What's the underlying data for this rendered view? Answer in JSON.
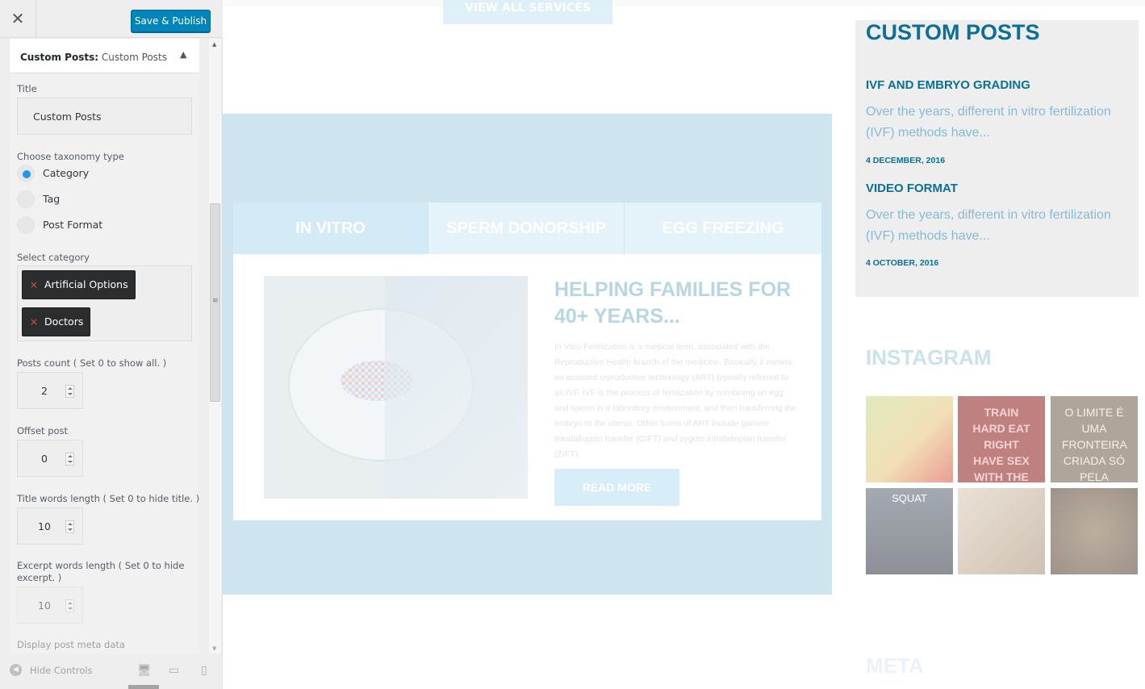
{
  "topbar": {
    "close_glyph": "✕",
    "publish_label": "Save & Publish"
  },
  "panel": {
    "title_prefix": "Custom Posts:",
    "title_suffix": "Custom Posts",
    "collapse_glyph": "▲",
    "title_field": {
      "label": "Title",
      "value": "Custom Posts"
    },
    "taxonomy": {
      "label": "Choose taxonomy type",
      "options": [
        {
          "label": "Category",
          "checked": true
        },
        {
          "label": "Tag",
          "checked": false
        },
        {
          "label": "Post Format",
          "checked": false
        }
      ]
    },
    "category": {
      "label": "Select category",
      "remove_glyph": "×",
      "selected": [
        "Artificial Options",
        "Doctors"
      ]
    },
    "posts_count": {
      "label": "Posts count ( Set 0 to show all. )",
      "value": "2"
    },
    "offset_post": {
      "label": "Offset post",
      "value": "0"
    },
    "title_words": {
      "label": "Title words length ( Set 0 to hide title. )",
      "value": "10"
    },
    "excerpt_words": {
      "label": "Excerpt words length ( Set 0 to hide excerpt. )",
      "value": "10"
    },
    "meta_label": "Display post meta data"
  },
  "footer": {
    "hide_controls": "Hide Controls",
    "hide_glyph": "◀",
    "devices": [
      "desktop-icon",
      "tablet-icon",
      "mobile-icon"
    ],
    "device_glyphs": {
      "desktop": "🖥",
      "tablet": "▭",
      "mobile": "▯"
    }
  },
  "scrollbar": {
    "up": "▲",
    "down": "▼",
    "grip": "≡"
  },
  "preview": {
    "view_all_label": "VIEW ALL SERVICES",
    "tabs": [
      "IN VITRO",
      "SPERM DONORSHIP",
      "EGG FREEZING"
    ],
    "heading": "HELPING FAMILIES FOR 40+ YEARS...",
    "body_text": "In Vitro Fertilization is a medical term, associated with the Reproductive Health branch of the medicine. Basically it means an assisted reproductive technology (ART) typically referred to as IVF. IVF is the process of fertilization by combining an egg and sperm in a laboratory environment, and then transferring the embryo to the uterus. Other forms of ART include gamete intrafallopian transfer (GIFT) and zygote intrafallopian transfer (ZIFT).",
    "read_more_label": "READ MORE",
    "custom_posts": {
      "title": "CUSTOM POSTS",
      "posts": [
        {
          "title": "IVF AND EMBRYO GRADING",
          "excerpt": "Over the years, different in vitro fertilization (IVF) methods have...",
          "date": "4 DECEMBER, 2016"
        },
        {
          "title": "VIDEO FORMAT",
          "excerpt": "Over the years, different in vitro fertilization (IVF) methods have...",
          "date": "4 OCTOBER, 2016"
        }
      ]
    },
    "instagram": {
      "title": "INSTAGRAM",
      "photos": [
        {
          "caption": ""
        },
        {
          "caption": "TRAIN HARD EAT RIGHT HAVE SEX WITH THE LIGHTS ON"
        },
        {
          "caption": "O LIMITE É UMA FRONTEIRA CRIADA SÓ PELA MENTE"
        },
        {
          "caption": "SQUAT"
        },
        {
          "caption": ""
        },
        {
          "caption": ""
        }
      ]
    },
    "meta_title": "META"
  },
  "colors": {
    "accent": "#0085ba",
    "heading_blue": "#0a6f99",
    "excerpt_blue": "#85bad8",
    "radio_on": "#2196f3",
    "chip_bg": "#2b2d2f"
  }
}
